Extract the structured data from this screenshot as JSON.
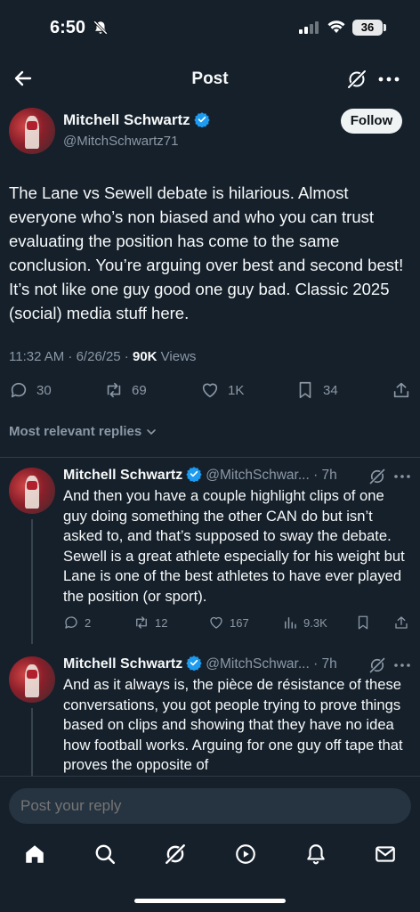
{
  "status_bar": {
    "time": "6:50",
    "battery": "36"
  },
  "header": {
    "title": "Post"
  },
  "main_post": {
    "author_name": "Mitchell Schwartz",
    "author_handle": "@MitchSchwartz71",
    "follow_label": "Follow",
    "text": "The Lane vs Sewell debate is hilarious. Almost everyone who’s non biased and who you can trust evaluating the position has come to the same conclusion. You’re arguing over best and second best! It’s not like one guy good one guy bad. Classic 2025 (social) media stuff here.",
    "timestamp": "11:32 AM · 6/26/25 · ",
    "views_count": "90K",
    "views_label": " Views",
    "replies": "30",
    "reposts": "69",
    "likes": "1K",
    "bookmarks": "34"
  },
  "replies_section": {
    "sort_label": "Most relevant replies"
  },
  "replies": [
    {
      "author_name": "Mitchell Schwartz",
      "author_handle": "@MitchSchwar... · 7h",
      "text": "And then you have a couple highlight clips of one guy doing something the other CAN do but isn’t asked to, and that’s supposed to sway the debate. Sewell is a great athlete especially for his weight but Lane is one of the best athletes to have ever played the position (or sport).",
      "replies": "2",
      "reposts": "12",
      "likes": "167",
      "views": "9.3K"
    },
    {
      "author_name": "Mitchell Schwartz",
      "author_handle": "@MitchSchwar... · 7h",
      "text": "And as it always is, the pièce de résistance of these conversations, you got people trying to prove things based on clips and showing that they have no idea how football works. Arguing for one guy off tape that proves the opposite of"
    }
  ],
  "composer": {
    "placeholder": "Post your reply"
  },
  "colors": {
    "background": "#15202b",
    "accent": "#1d9bf0",
    "muted": "#8b98a5"
  }
}
